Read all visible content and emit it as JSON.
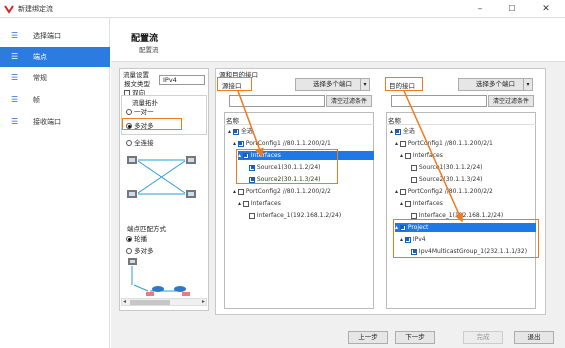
{
  "window": {
    "title": "新建绑定流",
    "minimize": "–",
    "maximize": "☐",
    "close": "✕"
  },
  "sidebar": {
    "items": [
      {
        "label": "选择端口",
        "icon": "list-icon"
      },
      {
        "label": "端点",
        "icon": "list-icon",
        "active": true
      },
      {
        "label": "常规",
        "icon": "list-icon"
      },
      {
        "label": "帧",
        "icon": "list-icon"
      },
      {
        "label": "接收端口",
        "icon": "list-icon"
      }
    ]
  },
  "header": {
    "title": "配置流",
    "subtitle": "配置流"
  },
  "settings": {
    "group_title": "流量设置",
    "packet_type_label": "报文类型",
    "packet_type_value": "IPv4",
    "bidirectional_label": "双向",
    "topology_label": "流量拓扑",
    "topo_options": [
      "一对一",
      "多对多",
      "全连接"
    ],
    "topo_selected": "多对多",
    "endpoint_match_label": "端点匹配方式",
    "match_options": [
      "轮播",
      "多对多"
    ],
    "match_selected": "轮播"
  },
  "endpoints": {
    "group_title": "源和目的接口",
    "source": {
      "title": "源接口",
      "select_button": "选择多个端口",
      "filter_button": "清空过滤条件",
      "column": "名称",
      "tree": [
        {
          "label": "全选",
          "level": 0
        },
        {
          "label": "PortConfig1 //80.1.1.200/2/1",
          "level": 1
        },
        {
          "label": "Interfaces",
          "level": 2,
          "highlight": true
        },
        {
          "label": "Source1(30.1.1.2/24)",
          "level": 3
        },
        {
          "label": "Source2(30.1.1.3/24)",
          "level": 3
        },
        {
          "label": "PortConfig2 //80.1.1.200/2/2",
          "level": 1
        },
        {
          "label": "Interfaces",
          "level": 2
        },
        {
          "label": "Interface_1(192.168.1.2/24)",
          "level": 3
        }
      ]
    },
    "destination": {
      "title": "目的接口",
      "select_button": "选择多个端口",
      "filter_button": "清空过滤条件",
      "column": "名称",
      "tree": [
        {
          "label": "全选",
          "level": 0
        },
        {
          "label": "PortConfig1 //80.1.1.200/2/1",
          "level": 1
        },
        {
          "label": "Interfaces",
          "level": 2
        },
        {
          "label": "Source1(30.1.1.2/24)",
          "level": 3
        },
        {
          "label": "Source2(30.1.1.3/24)",
          "level": 3
        },
        {
          "label": "PortConfig2 //80.1.1.200/2/2",
          "level": 1
        },
        {
          "label": "Interfaces",
          "level": 2
        },
        {
          "label": "Interface_1(192.168.1.2/24)",
          "level": 3
        },
        {
          "label": "Project",
          "level": 1,
          "highlight": true
        },
        {
          "label": "IPv4",
          "level": 2
        },
        {
          "label": "Ipv4MulticastGroup_1(232.1.1.1/32)",
          "level": 3
        }
      ]
    }
  },
  "footer": {
    "prev": "上一步",
    "next": "下一步",
    "finish": "完成",
    "exit": "退出"
  }
}
